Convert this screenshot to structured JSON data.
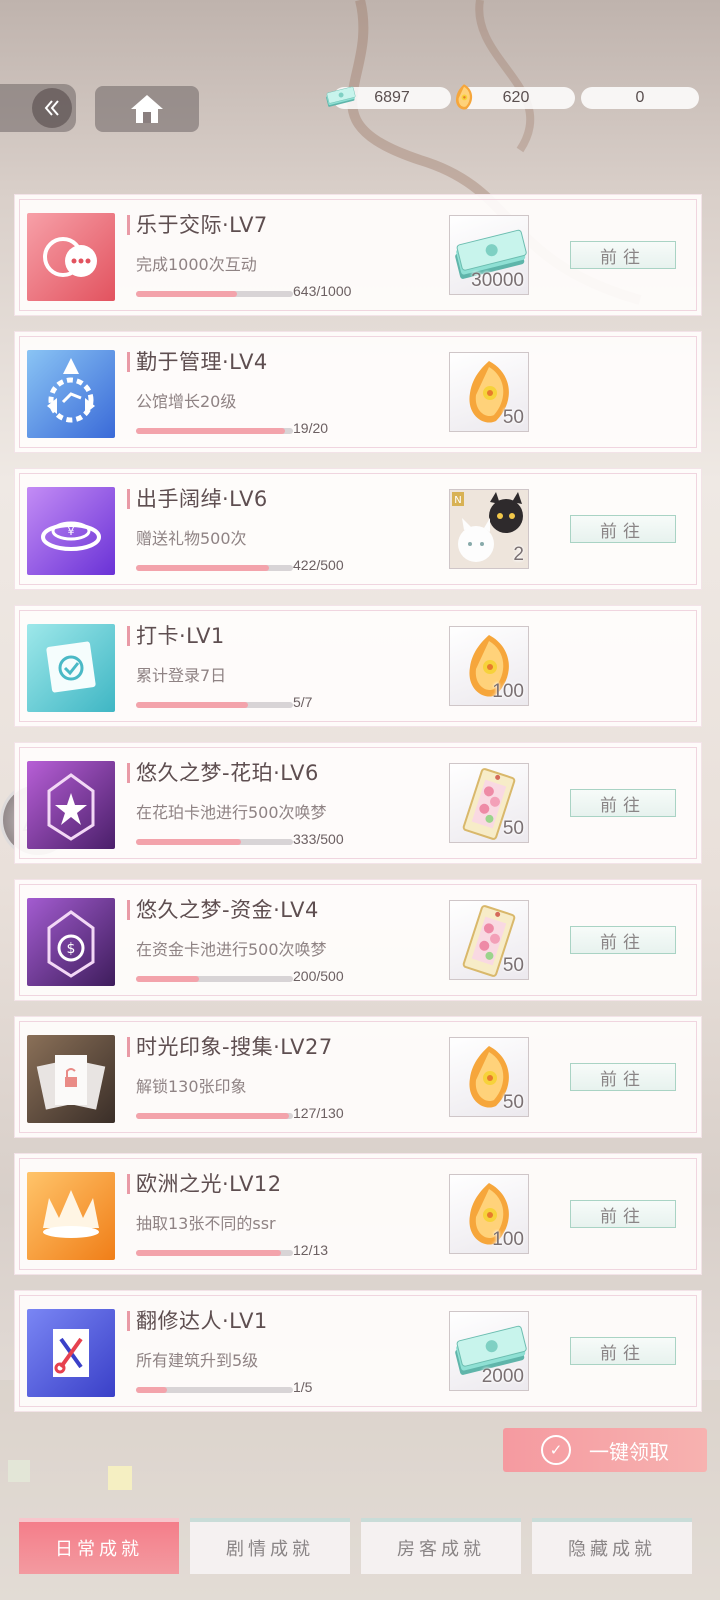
{
  "currencies": [
    {
      "icon": "cash-icon",
      "value": "6897"
    },
    {
      "icon": "amber-gem-icon",
      "value": "620"
    },
    {
      "icon": "feather-ticket-icon",
      "value": "0"
    }
  ],
  "achievements": [
    {
      "title": "乐于交际·LV7",
      "desc": "完成1000次互动",
      "progress_text": "643/1000",
      "progress": 0.643,
      "reward_icon": "cash-icon",
      "reward_count": "30000",
      "goto": "前往",
      "icon_name": "chat-bubbles-icon",
      "icon_colors": [
        "#f7a0a8",
        "#e2535f"
      ]
    },
    {
      "title": "勤于管理·LV4",
      "desc": "公馆增长20级",
      "progress_text": "19/20",
      "progress": 0.95,
      "reward_icon": "amber-gem-icon",
      "reward_count": "50",
      "goto": "",
      "icon_name": "gear-emblem-icon",
      "icon_colors": [
        "#8ac4f4",
        "#3a6ad8"
      ]
    },
    {
      "title": "出手阔绰·LV6",
      "desc": "赠送礼物500次",
      "progress_text": "422/500",
      "progress": 0.844,
      "reward_icon": "cat-card-icon",
      "reward_count": "2",
      "goto": "前往",
      "icon_name": "coin-ring-icon",
      "icon_colors": [
        "#c38cf5",
        "#6a32d6"
      ]
    },
    {
      "title": "打卡·LV1",
      "desc": "累计登录7日",
      "progress_text": "5/7",
      "progress": 0.714,
      "reward_icon": "amber-gem-icon",
      "reward_count": "100",
      "goto": "",
      "icon_name": "check-card-icon",
      "icon_colors": [
        "#9ee8ea",
        "#3fb6c4"
      ]
    },
    {
      "title": "悠久之梦-花珀·LV6",
      "desc": "在花珀卡池进行500次唤梦",
      "progress_text": "333/500",
      "progress": 0.666,
      "reward_icon": "flower-ticket-icon",
      "reward_count": "50",
      "goto": "前往",
      "icon_name": "star-crest-icon",
      "icon_colors": [
        "#b75fd6",
        "#4a1f6a"
      ]
    },
    {
      "title": "悠久之梦-资金·LV4",
      "desc": "在资金卡池进行500次唤梦",
      "progress_text": "200/500",
      "progress": 0.4,
      "reward_icon": "flower-ticket-icon",
      "reward_count": "50",
      "goto": "前往",
      "icon_name": "coin-crest-icon",
      "icon_colors": [
        "#a35cd0",
        "#3e1d5c"
      ]
    },
    {
      "title": "时光印象-搜集·LV27",
      "desc": "解锁130张印象",
      "progress_text": "127/130",
      "progress": 0.977,
      "reward_icon": "amber-gem-icon",
      "reward_count": "50",
      "goto": "前往",
      "icon_name": "unlock-cards-icon",
      "icon_colors": [
        "#8a7058",
        "#3a2e28"
      ]
    },
    {
      "title": "欧洲之光·LV12",
      "desc": "抽取13张不同的ssr",
      "progress_text": "12/13",
      "progress": 0.923,
      "reward_icon": "amber-gem-icon",
      "reward_count": "100",
      "goto": "前往",
      "icon_name": "crown-icon",
      "icon_colors": [
        "#ffc46a",
        "#f07e18"
      ]
    },
    {
      "title": "翻修达人·LV1",
      "desc": "所有建筑升到5级",
      "progress_text": "1/5",
      "progress": 0.2,
      "reward_icon": "cash-icon",
      "reward_count": "2000",
      "goto": "前往",
      "icon_name": "tools-icon",
      "icon_colors": [
        "#7a86f4",
        "#3a40c8"
      ]
    }
  ],
  "claim_all_label": "一键领取",
  "tabs": [
    {
      "label": "日常成就",
      "active": true
    },
    {
      "label": "剧情成就",
      "active": false
    },
    {
      "label": "房客成就",
      "active": false
    },
    {
      "label": "隐藏成就",
      "active": false
    }
  ]
}
